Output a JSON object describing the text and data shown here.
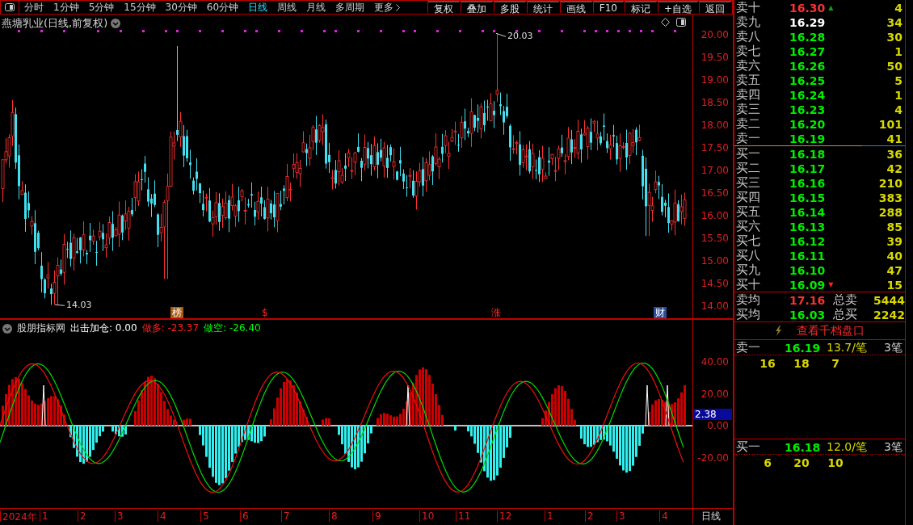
{
  "toolbar": {
    "periods": [
      {
        "label": "分时",
        "selected": false
      },
      {
        "label": "1分钟",
        "selected": false
      },
      {
        "label": "5分钟",
        "selected": false
      },
      {
        "label": "15分钟",
        "selected": false
      },
      {
        "label": "30分钟",
        "selected": false
      },
      {
        "label": "60分钟",
        "selected": false
      },
      {
        "label": "日线",
        "selected": true
      },
      {
        "label": "周线",
        "selected": false
      },
      {
        "label": "月线",
        "selected": false
      },
      {
        "label": "多周期",
        "selected": false
      },
      {
        "label": "更多",
        "selected": false
      }
    ],
    "buttons": [
      "复权",
      "叠加",
      "多股",
      "统计",
      "画线",
      "F10",
      "标记",
      "+自选",
      "返回"
    ]
  },
  "chart": {
    "title": "燕塘乳业(日线,前复权)",
    "high_label": "20.03",
    "low_label": "14.03",
    "price_ticks": [
      "20.00",
      "19.50",
      "19.00",
      "18.50",
      "18.00",
      "17.50",
      "17.00",
      "16.50",
      "16.00",
      "15.50",
      "15.00",
      "14.50",
      "14.00"
    ],
    "events": [
      {
        "label": "榜",
        "kind": "badge",
        "color": "#a85a10"
      },
      {
        "label": "$",
        "kind": "text"
      },
      {
        "label": "涨",
        "kind": "text"
      },
      {
        "label": "财",
        "kind": "badge",
        "color": "#2a4f9a"
      }
    ]
  },
  "indicator": {
    "name": "股朋指标网",
    "values": [
      {
        "label": "出击加仓: 0.00",
        "color": "#ffffff"
      },
      {
        "label": "做多: -23.37",
        "color": "#ff2020"
      },
      {
        "label": "做空: -26.40",
        "color": "#00ff00"
      }
    ],
    "ticks": [
      "40.00",
      "20.00",
      "0.00",
      "-20.00"
    ],
    "current": "2.38"
  },
  "time_axis": {
    "labels": [
      "2024年",
      "1",
      "2",
      "3",
      "4",
      "5",
      "6",
      "7",
      "8",
      "9",
      "10",
      "11",
      "12",
      "1",
      "2",
      "3",
      "4"
    ],
    "period": "日线"
  },
  "order_book": {
    "asks": [
      {
        "name": "卖十",
        "price": "16.30",
        "volume": "4",
        "color": "#ff3030",
        "arrow": "▲"
      },
      {
        "name": "卖九",
        "price": "16.29",
        "volume": "34",
        "color": "#ffffff"
      },
      {
        "name": "卖八",
        "price": "16.28",
        "volume": "30",
        "color": "#00ee00"
      },
      {
        "name": "卖七",
        "price": "16.27",
        "volume": "1",
        "color": "#00ee00"
      },
      {
        "name": "卖六",
        "price": "16.26",
        "volume": "50",
        "color": "#00ee00"
      },
      {
        "name": "卖五",
        "price": "16.25",
        "volume": "5",
        "color": "#00ee00"
      },
      {
        "name": "卖四",
        "price": "16.24",
        "volume": "1",
        "color": "#00ee00"
      },
      {
        "name": "卖三",
        "price": "16.23",
        "volume": "4",
        "color": "#00ee00"
      },
      {
        "name": "卖二",
        "price": "16.20",
        "volume": "101",
        "color": "#00ee00"
      },
      {
        "name": "卖一",
        "price": "16.19",
        "volume": "41",
        "color": "#00ee00"
      }
    ],
    "bids": [
      {
        "name": "买一",
        "price": "16.18",
        "volume": "36",
        "color": "#00ee00"
      },
      {
        "name": "买二",
        "price": "16.17",
        "volume": "42",
        "color": "#00ee00"
      },
      {
        "name": "买三",
        "price": "16.16",
        "volume": "210",
        "color": "#00ee00"
      },
      {
        "name": "买四",
        "price": "16.15",
        "volume": "383",
        "color": "#00ee00"
      },
      {
        "name": "买五",
        "price": "16.14",
        "volume": "288",
        "color": "#00ee00"
      },
      {
        "name": "买六",
        "price": "16.13",
        "volume": "85",
        "color": "#00ee00"
      },
      {
        "name": "买七",
        "price": "16.12",
        "volume": "39",
        "color": "#00ee00"
      },
      {
        "name": "买八",
        "price": "16.11",
        "volume": "40",
        "color": "#00ee00"
      },
      {
        "name": "买九",
        "price": "16.10",
        "volume": "47",
        "color": "#00ee00"
      },
      {
        "name": "买十",
        "price": "16.09",
        "volume": "15",
        "color": "#00ee00",
        "arrow": "▼"
      }
    ],
    "summary": [
      {
        "label": "卖均",
        "price": "17.16",
        "color": "#ff3030",
        "total_label": "总卖",
        "total": "5444"
      },
      {
        "label": "买均",
        "price": "16.03",
        "color": "#00ee00",
        "total_label": "总买",
        "total": "2242"
      }
    ],
    "depth_button": "查看千档盘口",
    "queues": [
      {
        "side": "卖一",
        "price": "16.19",
        "avg": "13.7/笔",
        "count": "3笔",
        "orders": [
          "16",
          "18",
          "7"
        ]
      },
      {
        "side": "买一",
        "price": "16.18",
        "avg": "12.0/笔",
        "count": "3笔",
        "orders": [
          "6",
          "20",
          "10"
        ]
      }
    ]
  }
}
